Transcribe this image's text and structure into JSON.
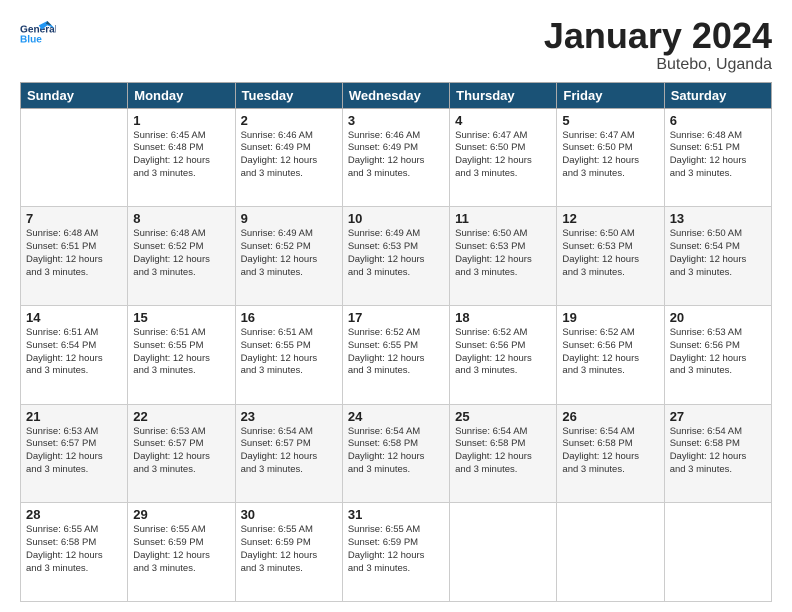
{
  "header": {
    "logo_line1": "General",
    "logo_line2": "Blue",
    "title": "January 2024",
    "location": "Butebo, Uganda"
  },
  "columns": [
    "Sunday",
    "Monday",
    "Tuesday",
    "Wednesday",
    "Thursday",
    "Friday",
    "Saturday"
  ],
  "weeks": [
    [
      {
        "day": "",
        "info": ""
      },
      {
        "day": "1",
        "info": "Sunrise: 6:45 AM\nSunset: 6:48 PM\nDaylight: 12 hours\nand 3 minutes."
      },
      {
        "day": "2",
        "info": "Sunrise: 6:46 AM\nSunset: 6:49 PM\nDaylight: 12 hours\nand 3 minutes."
      },
      {
        "day": "3",
        "info": "Sunrise: 6:46 AM\nSunset: 6:49 PM\nDaylight: 12 hours\nand 3 minutes."
      },
      {
        "day": "4",
        "info": "Sunrise: 6:47 AM\nSunset: 6:50 PM\nDaylight: 12 hours\nand 3 minutes."
      },
      {
        "day": "5",
        "info": "Sunrise: 6:47 AM\nSunset: 6:50 PM\nDaylight: 12 hours\nand 3 minutes."
      },
      {
        "day": "6",
        "info": "Sunrise: 6:48 AM\nSunset: 6:51 PM\nDaylight: 12 hours\nand 3 minutes."
      }
    ],
    [
      {
        "day": "7",
        "info": "Sunrise: 6:48 AM\nSunset: 6:51 PM\nDaylight: 12 hours\nand 3 minutes."
      },
      {
        "day": "8",
        "info": "Sunrise: 6:48 AM\nSunset: 6:52 PM\nDaylight: 12 hours\nand 3 minutes."
      },
      {
        "day": "9",
        "info": "Sunrise: 6:49 AM\nSunset: 6:52 PM\nDaylight: 12 hours\nand 3 minutes."
      },
      {
        "day": "10",
        "info": "Sunrise: 6:49 AM\nSunset: 6:53 PM\nDaylight: 12 hours\nand 3 minutes."
      },
      {
        "day": "11",
        "info": "Sunrise: 6:50 AM\nSunset: 6:53 PM\nDaylight: 12 hours\nand 3 minutes."
      },
      {
        "day": "12",
        "info": "Sunrise: 6:50 AM\nSunset: 6:53 PM\nDaylight: 12 hours\nand 3 minutes."
      },
      {
        "day": "13",
        "info": "Sunrise: 6:50 AM\nSunset: 6:54 PM\nDaylight: 12 hours\nand 3 minutes."
      }
    ],
    [
      {
        "day": "14",
        "info": "Sunrise: 6:51 AM\nSunset: 6:54 PM\nDaylight: 12 hours\nand 3 minutes."
      },
      {
        "day": "15",
        "info": "Sunrise: 6:51 AM\nSunset: 6:55 PM\nDaylight: 12 hours\nand 3 minutes."
      },
      {
        "day": "16",
        "info": "Sunrise: 6:51 AM\nSunset: 6:55 PM\nDaylight: 12 hours\nand 3 minutes."
      },
      {
        "day": "17",
        "info": "Sunrise: 6:52 AM\nSunset: 6:55 PM\nDaylight: 12 hours\nand 3 minutes."
      },
      {
        "day": "18",
        "info": "Sunrise: 6:52 AM\nSunset: 6:56 PM\nDaylight: 12 hours\nand 3 minutes."
      },
      {
        "day": "19",
        "info": "Sunrise: 6:52 AM\nSunset: 6:56 PM\nDaylight: 12 hours\nand 3 minutes."
      },
      {
        "day": "20",
        "info": "Sunrise: 6:53 AM\nSunset: 6:56 PM\nDaylight: 12 hours\nand 3 minutes."
      }
    ],
    [
      {
        "day": "21",
        "info": "Sunrise: 6:53 AM\nSunset: 6:57 PM\nDaylight: 12 hours\nand 3 minutes."
      },
      {
        "day": "22",
        "info": "Sunrise: 6:53 AM\nSunset: 6:57 PM\nDaylight: 12 hours\nand 3 minutes."
      },
      {
        "day": "23",
        "info": "Sunrise: 6:54 AM\nSunset: 6:57 PM\nDaylight: 12 hours\nand 3 minutes."
      },
      {
        "day": "24",
        "info": "Sunrise: 6:54 AM\nSunset: 6:58 PM\nDaylight: 12 hours\nand 3 minutes."
      },
      {
        "day": "25",
        "info": "Sunrise: 6:54 AM\nSunset: 6:58 PM\nDaylight: 12 hours\nand 3 minutes."
      },
      {
        "day": "26",
        "info": "Sunrise: 6:54 AM\nSunset: 6:58 PM\nDaylight: 12 hours\nand 3 minutes."
      },
      {
        "day": "27",
        "info": "Sunrise: 6:54 AM\nSunset: 6:58 PM\nDaylight: 12 hours\nand 3 minutes."
      }
    ],
    [
      {
        "day": "28",
        "info": "Sunrise: 6:55 AM\nSunset: 6:58 PM\nDaylight: 12 hours\nand 3 minutes."
      },
      {
        "day": "29",
        "info": "Sunrise: 6:55 AM\nSunset: 6:59 PM\nDaylight: 12 hours\nand 3 minutes."
      },
      {
        "day": "30",
        "info": "Sunrise: 6:55 AM\nSunset: 6:59 PM\nDaylight: 12 hours\nand 3 minutes."
      },
      {
        "day": "31",
        "info": "Sunrise: 6:55 AM\nSunset: 6:59 PM\nDaylight: 12 hours\nand 3 minutes."
      },
      {
        "day": "",
        "info": ""
      },
      {
        "day": "",
        "info": ""
      },
      {
        "day": "",
        "info": ""
      }
    ]
  ]
}
